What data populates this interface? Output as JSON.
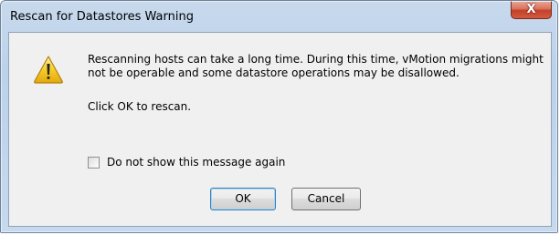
{
  "window": {
    "title": "Rescan for Datastores Warning",
    "close_icon": "close-icon",
    "close_glyph": "X"
  },
  "dialog": {
    "icon": "warning-icon",
    "message": "Rescanning hosts can take a long time. During this time, vMotion migrations might not be operable and some datastore operations may be disallowed.",
    "hint": "Click OK to rescan.",
    "checkbox": {
      "label": "Do not show this message again",
      "checked": false
    }
  },
  "buttons": {
    "ok_label": "OK",
    "cancel_label": "Cancel"
  },
  "colors": {
    "close_button": "#c4412a",
    "warning_yellow": "#f6cd2a",
    "dialog_background": "#f0f0f0",
    "frame": "#bcd2ea"
  }
}
